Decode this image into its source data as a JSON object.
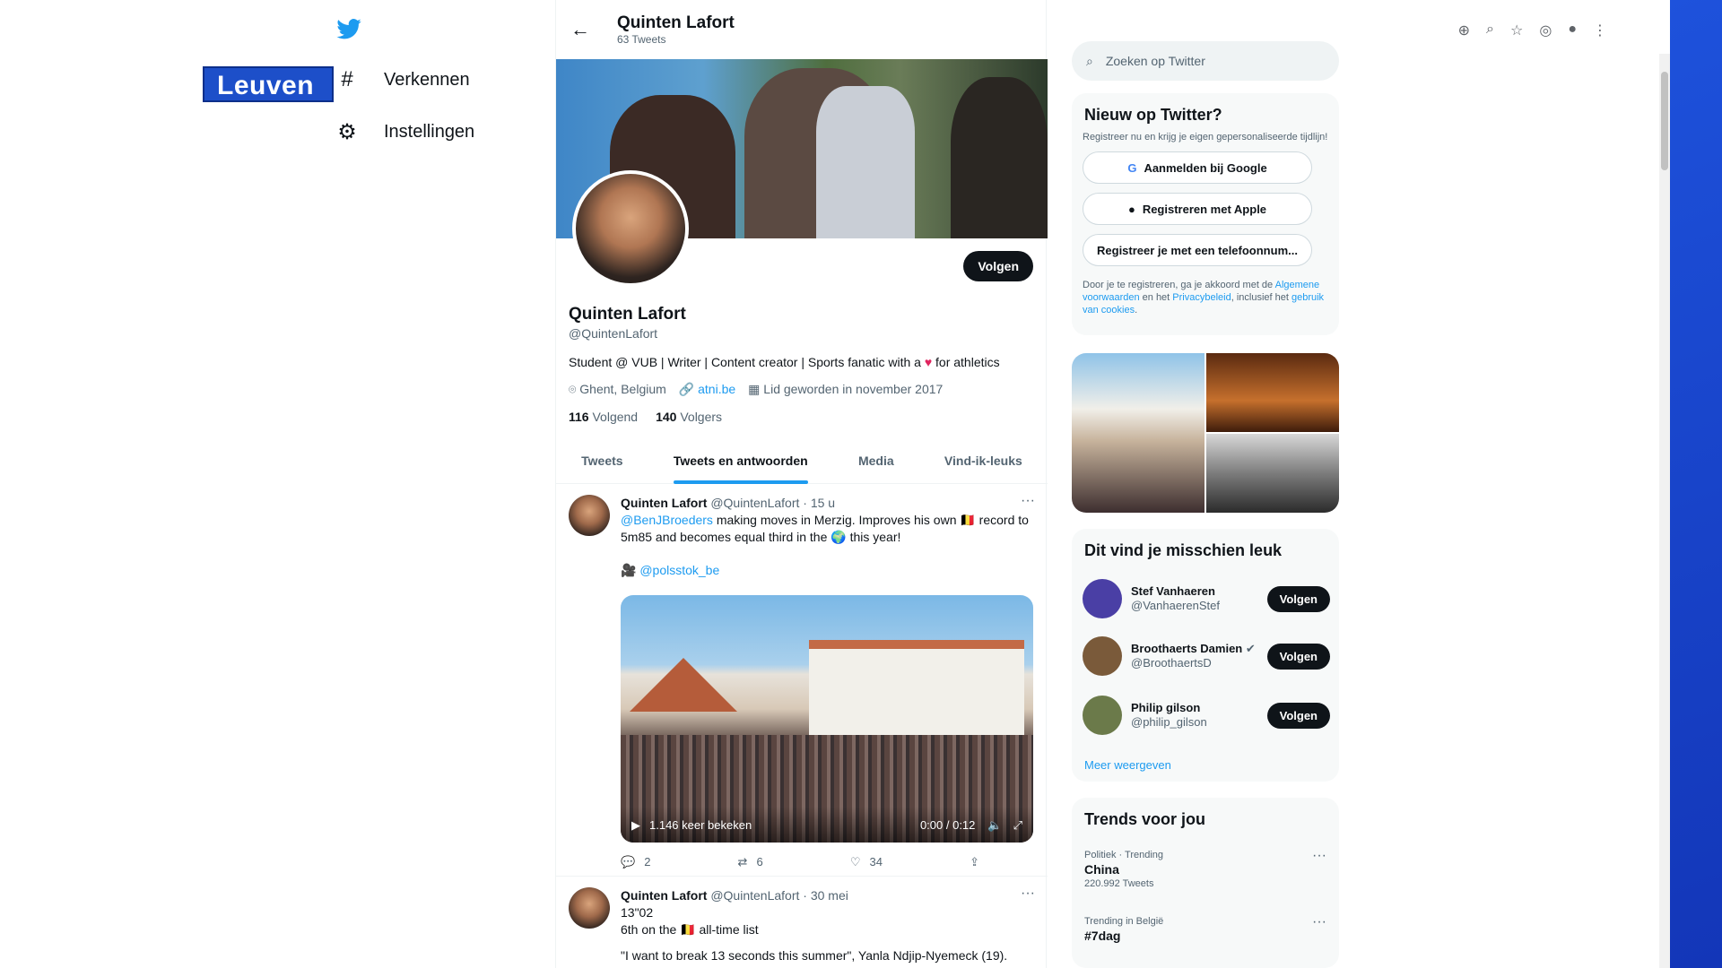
{
  "left_nav": {
    "badge": "Leuven",
    "items": [
      {
        "icon": "hashtag-icon",
        "glyph": "#",
        "label": "Verkennen"
      },
      {
        "icon": "gear-icon",
        "glyph": "⚙",
        "label": "Instellingen"
      }
    ]
  },
  "header": {
    "name": "Quinten Lafort",
    "tweets_count": "63 Tweets"
  },
  "profile": {
    "follow_label": "Volgen",
    "name": "Quinten Lafort",
    "handle": "@QuintenLafort",
    "bio_before": "Student @ VUB | Writer | Content creator | Sports fanatic with a",
    "bio_after": "for athletics",
    "location": "Ghent, Belgium",
    "website": "atni.be",
    "joined": "Lid geworden in november 2017",
    "following_count": "116",
    "following_label": "Volgend",
    "followers_count": "140",
    "followers_label": "Volgers"
  },
  "tabs": [
    "Tweets",
    "Tweets en antwoorden",
    "Media",
    "Vind-ik-leuks"
  ],
  "tweets": [
    {
      "name": "Quinten Lafort",
      "meta": "@QuintenLafort · 15 u",
      "mention": "@BenJBroeders",
      "text1": " making moves in Merzig. Improves his own 🇧🇪 record to 5m85 and becomes equal third in the 🌍 this year!",
      "credit": "@polsstok_be",
      "views": "1.146 keer bekeken",
      "time": "0:00 / 0:12",
      "replies": "2",
      "retweets": "6",
      "likes": "34"
    },
    {
      "name": "Quinten Lafort",
      "meta": "@QuintenLafort · 30 mei",
      "line1": "13\"02",
      "line2": "6th on the 🇧🇪 all-time list",
      "line3": "\"I want to break 13 seconds this summer\", Yanla Ndjip-Nyemeck (19)."
    }
  ],
  "right": {
    "search_placeholder": "Zoeken op Twitter",
    "new_title": "Nieuw op Twitter?",
    "new_sub": "Registreer nu en krijg je eigen gepersonaliseerde tijdlijn!",
    "google": "Aanmelden bij Google",
    "apple": "Registreren met Apple",
    "phone": "Registreer je met een telefoonnum...",
    "legal_1": "Door je te registreren, ga je akkoord met de ",
    "legal_link1": "Algemene voorwaarden",
    "legal_2": " en het ",
    "legal_link2": "Privacybeleid",
    "legal_3": ", inclusief het ",
    "legal_link3": "gebruik van cookies",
    "legal_4": ".",
    "wtf_title": "Dit vind je misschien leuk",
    "wtf": [
      {
        "name": "Stef Vanhaeren",
        "handle": "@VanhaerenStef",
        "verified": false,
        "color": "#4a3fa5"
      },
      {
        "name": "Broothaerts Damien",
        "handle": "@BroothaertsD",
        "verified": true,
        "color": "#7a5a3a"
      },
      {
        "name": "Philip gilson",
        "handle": "@philip_gilson",
        "verified": false,
        "color": "#6b7a4a"
      }
    ],
    "follow_label": "Volgen",
    "more": "Meer weergeven",
    "trends_title": "Trends voor jou",
    "trends": [
      {
        "context": "Politiek · Trending",
        "name": "China",
        "count": "220.992 Tweets"
      },
      {
        "context": "Trending in België",
        "name": "#7dag",
        "count": ""
      }
    ]
  }
}
